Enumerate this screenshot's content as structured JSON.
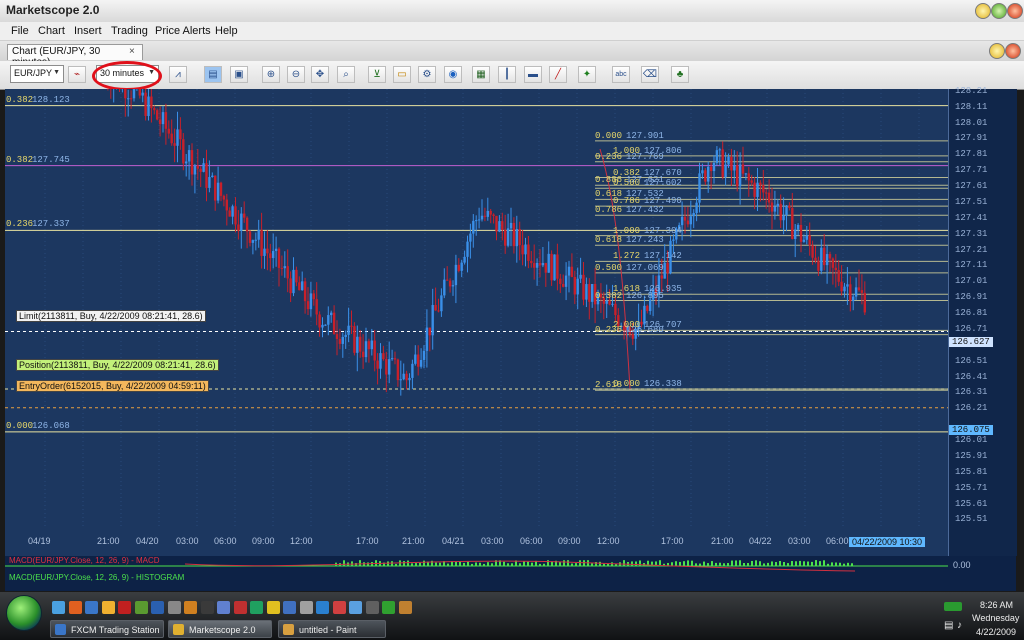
{
  "app": {
    "title": "Marketscope 2.0"
  },
  "menu": [
    "File",
    "Chart",
    "Insert",
    "Trading",
    "Price Alerts",
    "Help"
  ],
  "tab": {
    "label": "Chart (EUR/JPY, 30 minutes)",
    "close": "×"
  },
  "toolbar": {
    "symbol": "EUR/JPY",
    "timeframe": "30 minutes"
  },
  "price_axis": [
    "128.21",
    "128.11",
    "128.01",
    "127.91",
    "127.81",
    "127.71",
    "127.61",
    "127.51",
    "127.41",
    "127.31",
    "127.21",
    "127.11",
    "127.01",
    "126.91",
    "126.81",
    "126.71",
    "126.51",
    "126.41",
    "126.31",
    "126.21",
    "126.01",
    "125.91",
    "125.81",
    "125.71",
    "125.61",
    "125.51"
  ],
  "price_markers": {
    "current": "126.627",
    "level": "126.075"
  },
  "time_axis": [
    "04/19",
    "21:00",
    "04/20",
    "03:00",
    "06:00",
    "09:00",
    "12:00",
    "17:00",
    "21:00",
    "04/21",
    "03:00",
    "06:00",
    "09:00",
    "12:00",
    "17:00",
    "21:00",
    "04/22",
    "03:00",
    "06:00"
  ],
  "time_marker": "04/22/2009 10:30",
  "fib_left": [
    {
      "ratio": "0.382",
      "price": "128.123"
    },
    {
      "ratio": "0.382",
      "price": "127.745"
    },
    {
      "ratio": "0.236",
      "price": "127.337"
    },
    {
      "ratio": "0.000",
      "price": "126.068"
    }
  ],
  "fib_right": [
    {
      "ratio": "0.000",
      "price": "127.901"
    },
    {
      "ratio": "1.000",
      "price": "127.806"
    },
    {
      "ratio": "0.236",
      "price": "127.769"
    },
    {
      "ratio": "0.382",
      "price": "127.670"
    },
    {
      "ratio": "0.886",
      "price": "127.621"
    },
    {
      "ratio": "0.500",
      "price": "127.602"
    },
    {
      "ratio": "0.618",
      "price": "127.532"
    },
    {
      "ratio": "0.786",
      "price": "127.490"
    },
    {
      "ratio": "0.786",
      "price": "127.432"
    },
    {
      "ratio": "1.000",
      "price": "127.304"
    },
    {
      "ratio": "0.618",
      "price": "127.243"
    },
    {
      "ratio": "1.272",
      "price": "127.142"
    },
    {
      "ratio": "0.500",
      "price": "127.069"
    },
    {
      "ratio": "1.618",
      "price": "126.935"
    },
    {
      "ratio": "0.382",
      "price": "126.895"
    },
    {
      "ratio": "2.000",
      "price": "126.707"
    },
    {
      "ratio": "0.236",
      "price": "126.680"
    },
    {
      "ratio": "0.000",
      "price": "126.338"
    },
    {
      "ratio": "2.618",
      "price": ""
    }
  ],
  "orders": {
    "limit": "Limit(2113811, Buy, 4/22/2009 08:21:41, 28.6)",
    "position": "Position(2113811, Buy, 4/22/2009 08:21:41, 28.6)",
    "entry": "EntryOrder(6152015, Buy, 4/22/2009 04:59:11)"
  },
  "indicator": {
    "macd_label": "MACD(EUR/JPY.Close, 12, 26, 9) - MACD",
    "hist_label": "MACD(EUR/JPY.Close, 12, 26, 9) - HISTOGRAM",
    "value": "0.00"
  },
  "taskbar": {
    "items": [
      "FXCM Trading Station",
      "Marketscope 2.0",
      "untitled - Paint"
    ],
    "time": "8:26 AM",
    "day": "Wednesday",
    "date": "4/22/2009"
  },
  "colors": {
    "chart_bg": "#1c3760",
    "bull": "#3a8fe8",
    "bear": "#c8202a",
    "fib": "#e8e3a0",
    "accent_circle": "#e0101a"
  }
}
